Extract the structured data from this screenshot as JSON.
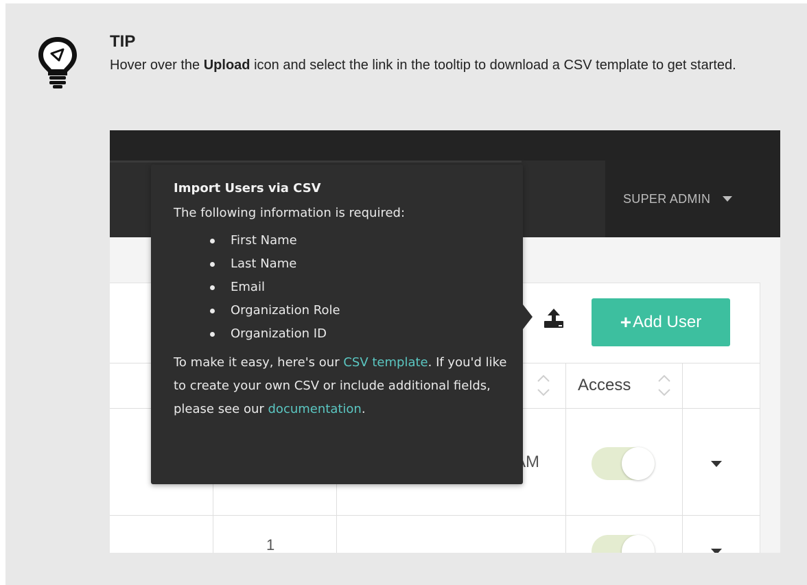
{
  "tip": {
    "icon": "lightbulb-icon",
    "title": "TIP",
    "text_before": "Hover over the ",
    "text_bold": "Upload",
    "text_after": " icon and select the link in the tooltip to download a CSV template to get started."
  },
  "app": {
    "user_menu_label": "SUPER ADMIN",
    "add_user_label": "Add User",
    "table": {
      "access_header": "Access",
      "row1_time_fragment": "AM",
      "row2_value": "1"
    },
    "colors": {
      "accent": "#3dbf9f",
      "link": "#5bc7c2",
      "navbar": "#2d2d2d"
    }
  },
  "tooltip": {
    "title": "Import Users via CSV",
    "subtitle": "The following information is required:",
    "fields": [
      "First Name",
      "Last Name",
      "Email",
      "Organization Role",
      "Organization ID"
    ],
    "para_1": "To make it easy, here's our ",
    "link_template": "CSV template",
    "para_2": ". If you'd like to create your own CSV or include additional fields, please see our ",
    "link_docs": "documentation",
    "para_3": "."
  }
}
